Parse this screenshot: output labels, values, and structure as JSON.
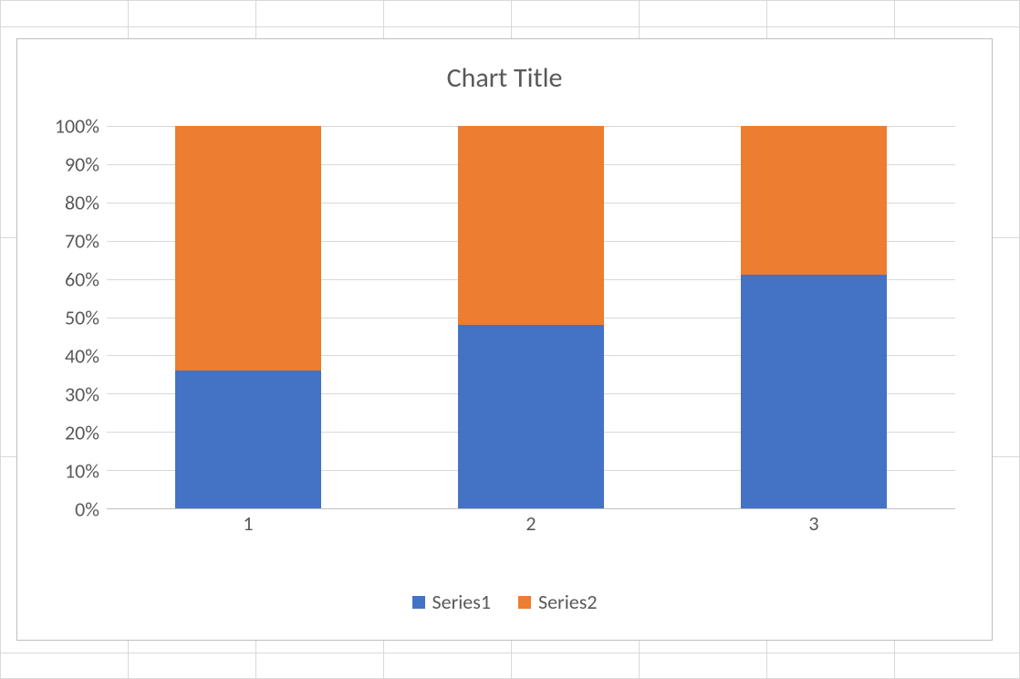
{
  "chart_data": {
    "type": "bar",
    "stacked": true,
    "stacked_100_percent": true,
    "title": "Chart Title",
    "categories": [
      "1",
      "2",
      "3"
    ],
    "series": [
      {
        "name": "Series1",
        "values": [
          36,
          48,
          61
        ],
        "color": "#4472C4"
      },
      {
        "name": "Series2",
        "values": [
          64,
          52,
          39
        ],
        "color": "#ED7D31"
      }
    ],
    "xlabel": "",
    "ylabel": "",
    "ylim": [
      0,
      100
    ],
    "y_ticks": [
      "0%",
      "10%",
      "20%",
      "30%",
      "40%",
      "50%",
      "60%",
      "70%",
      "80%",
      "90%",
      "100%"
    ],
    "legend_position": "bottom",
    "grid": true
  }
}
